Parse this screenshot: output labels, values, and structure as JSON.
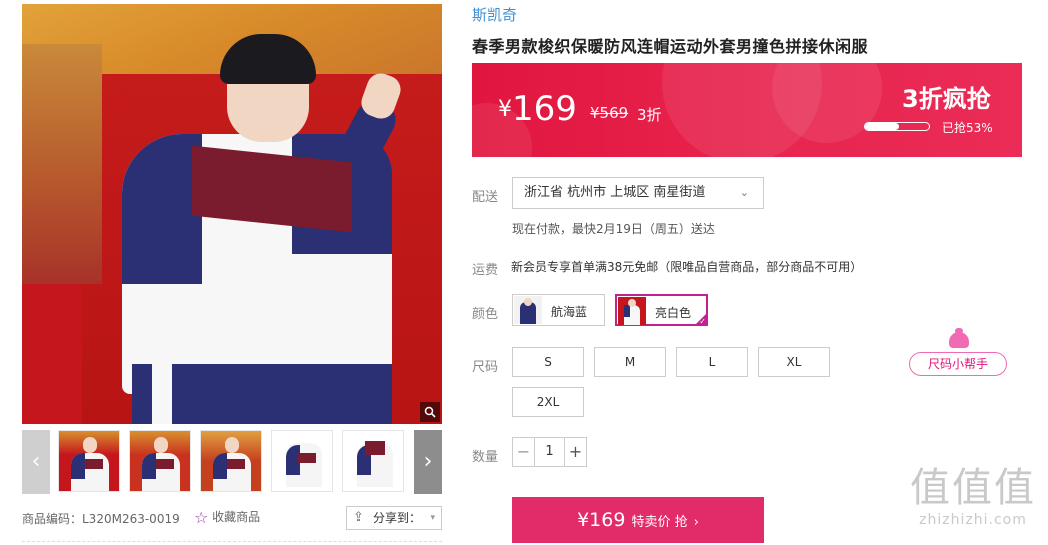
{
  "product": {
    "brand": "斯凯奇",
    "title": "春季男款梭织保暖防风连帽运动外套男撞色拼接休闲服",
    "code_label": "商品编码：L320M263-0019",
    "favorite_label": "收藏商品",
    "share_label": "分享到："
  },
  "price_banner": {
    "currency": "¥",
    "price": "169",
    "original_price": "¥569",
    "discount": "3折",
    "promo_title": "3折疯抢",
    "sold_label": "已抢53%",
    "sold_percent": 53,
    "colors": {
      "start": "#e1163e",
      "end": "#ea2c56"
    }
  },
  "delivery": {
    "label": "配送",
    "address": "浙江省 杭州市 上城区 南星街道",
    "note": "现在付款，最快2月19日（周五）送达"
  },
  "shipping": {
    "label": "运费",
    "text": "新会员专享首单满38元免邮（限唯品自营商品，部分商品不可用）"
  },
  "color": {
    "label": "颜色",
    "options": [
      {
        "name": "航海蓝",
        "selected": false
      },
      {
        "name": "亮白色",
        "selected": true
      }
    ],
    "accent": "#c3218f"
  },
  "size": {
    "label": "尺码",
    "options": [
      "S",
      "M",
      "L",
      "XL",
      "2XL"
    ],
    "helper_label": "尺码小帮手"
  },
  "quantity": {
    "label": "数量",
    "value": "1",
    "minus": "−",
    "plus": "+"
  },
  "buy_button": {
    "price": "¥169",
    "label": "特卖价 抢",
    "arrow": "›",
    "color": "#e22c6a"
  },
  "gallery": {
    "prev_icon": "‹",
    "next_icon": "›",
    "zoom_icon": "search-icon"
  },
  "watermark": {
    "glyphs": "值值值",
    "site": "zhizhizhi.com"
  }
}
